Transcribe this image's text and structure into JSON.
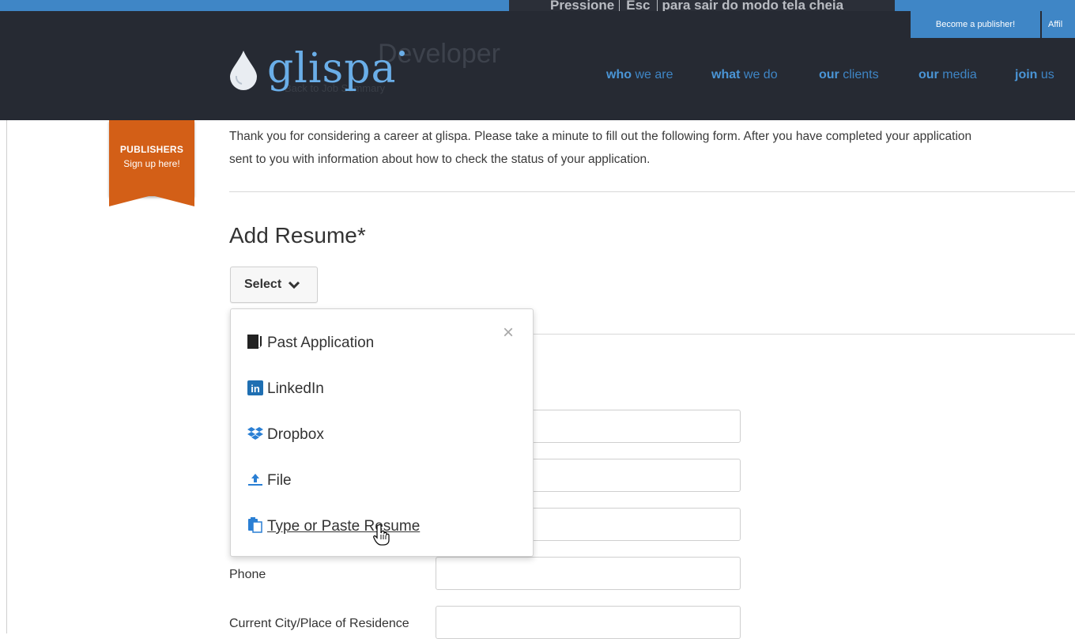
{
  "fullscreen_banner": {
    "before": "Pressione",
    "key": "Esc",
    "after": "para sair do modo tela cheia"
  },
  "top_links": {
    "publisher": "Become a publisher!",
    "affiliate": "Affil"
  },
  "brand": {
    "logo_text": "glispa",
    "accent": "#3f86c6"
  },
  "header_ghost": {
    "title": "Developer",
    "subtitle": "Back to Job Summary"
  },
  "nav": [
    {
      "bold": "who",
      "rest": "we are"
    },
    {
      "bold": "what",
      "rest": "we do"
    },
    {
      "bold": "our",
      "rest": "clients"
    },
    {
      "bold": "our",
      "rest": "media"
    },
    {
      "bold": "join",
      "rest": "us"
    }
  ],
  "ribbon": {
    "line1": "PUBLISHERS",
    "line2": "Sign up here!",
    "color": "#d35f17"
  },
  "intro": {
    "line1": "Thank you for considering a career at glispa. Please take a minute to fill out the following form. After you have completed your application",
    "line2": "sent to you with information about how to check the status of your application."
  },
  "resume": {
    "heading": "Add Resume*",
    "select_label": "Select",
    "close": "×",
    "options": [
      {
        "label": "Past Application",
        "icon": "document-icon"
      },
      {
        "label": "LinkedIn",
        "icon": "linkedin-icon"
      },
      {
        "label": "Dropbox",
        "icon": "dropbox-icon"
      },
      {
        "label": "File",
        "icon": "upload-icon"
      },
      {
        "label": "Type or Paste Resume",
        "icon": "paste-icon"
      }
    ]
  },
  "form": {
    "phone_label": "Phone",
    "city_label": "Current City/Place of Residence"
  }
}
